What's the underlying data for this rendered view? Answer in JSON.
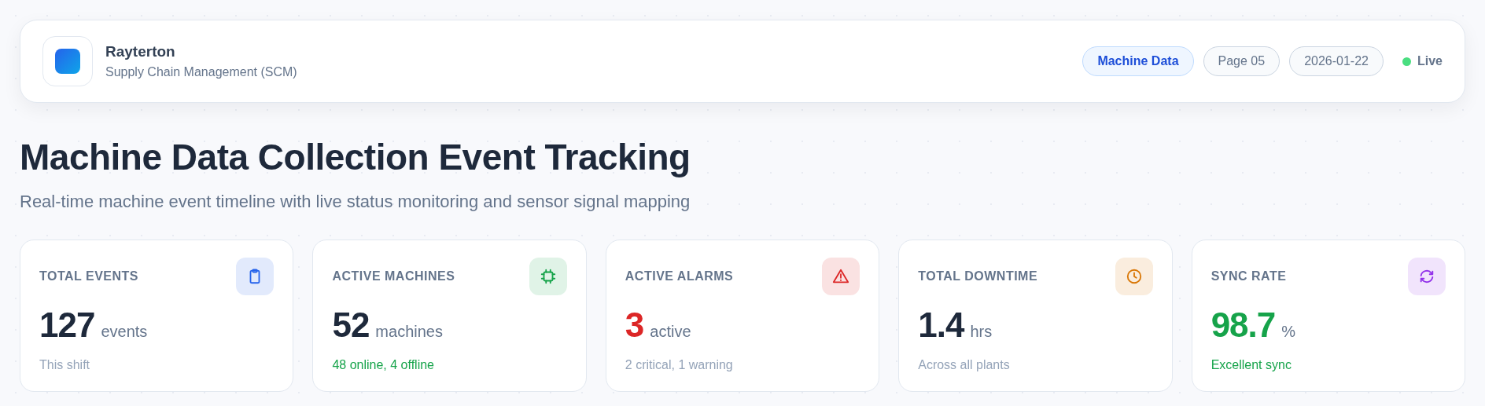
{
  "brand": {
    "name": "Rayterton",
    "subtitle": "Supply Chain Management (SCM)"
  },
  "badges": [
    {
      "label": "Machine Data",
      "kind": "primary"
    },
    {
      "label": "Page 05",
      "kind": "neutral"
    },
    {
      "label": "2026-01-22",
      "kind": "neutral"
    }
  ],
  "status": {
    "label": "Live",
    "color": "#4ade80"
  },
  "title": "Machine Data Collection Event Tracking",
  "subtitle": "Real-time machine event timeline with live status monitoring and sensor signal mapping",
  "cards": [
    {
      "label": "TOTAL EVENTS",
      "kind": "clipboard",
      "color": "#2563eb",
      "value": {
        "text": "127",
        "color": "#1e293b"
      },
      "unit": "events",
      "note": {
        "text": "This shift",
        "color": "#94a3b8"
      }
    },
    {
      "label": "ACTIVE MACHINES",
      "kind": "chip",
      "color": "#16a34a",
      "value": {
        "text": "52",
        "color": "#1e293b"
      },
      "unit": "machines",
      "note": {
        "text": "48 online, 4 offline",
        "color": "#16a34a"
      }
    },
    {
      "label": "ACTIVE ALARMS",
      "kind": "warning",
      "color": "#dc2626",
      "value": {
        "text": "3",
        "color": "#dc2626"
      },
      "unit": "active",
      "note": {
        "text": "2 critical, 1 warning",
        "color": "#94a3b8"
      }
    },
    {
      "label": "TOTAL DOWNTIME",
      "kind": "clock",
      "color": "#d97706",
      "value": {
        "text": "1.4",
        "color": "#1e293b"
      },
      "unit": "hrs",
      "note": {
        "text": "Across all plants",
        "color": "#94a3b8"
      }
    },
    {
      "label": "SYNC RATE",
      "kind": "sync",
      "color": "#9333ea",
      "value": {
        "text": "98.7",
        "color": "#16a34a"
      },
      "unit": "%",
      "note": {
        "text": "Excellent sync",
        "color": "#16a34a"
      }
    }
  ]
}
